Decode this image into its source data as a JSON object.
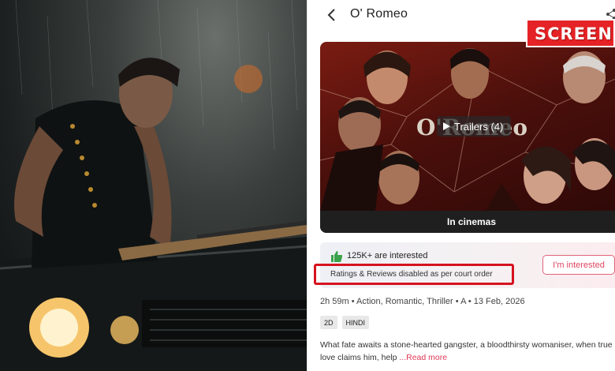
{
  "header": {
    "title": "O' Romeo"
  },
  "stamp": {
    "text": "SCREEN"
  },
  "poster": {
    "logo_text": "O'Romeo",
    "trailers_label": "Trailers (4)",
    "release_label": "In cinemas"
  },
  "interest": {
    "count_text": "125K+ are interested",
    "disabled_note": "Ratings & Reviews disabled as per court order",
    "button_label": "I'm interested"
  },
  "meta": {
    "text": "2h 59m • Action, Romantic, Thriller • A • 13 Feb, 2026"
  },
  "tags": [
    "2D",
    "HINDI"
  ],
  "synopsis": {
    "text": "What fate awaits a stone-hearted gangster, a bloodthirsty womaniser, when true love claims him, help ",
    "read_more": "...Read more"
  },
  "colors": {
    "accent": "#e0445f",
    "highlight": "#d6121e",
    "stamp": "#e52225"
  }
}
